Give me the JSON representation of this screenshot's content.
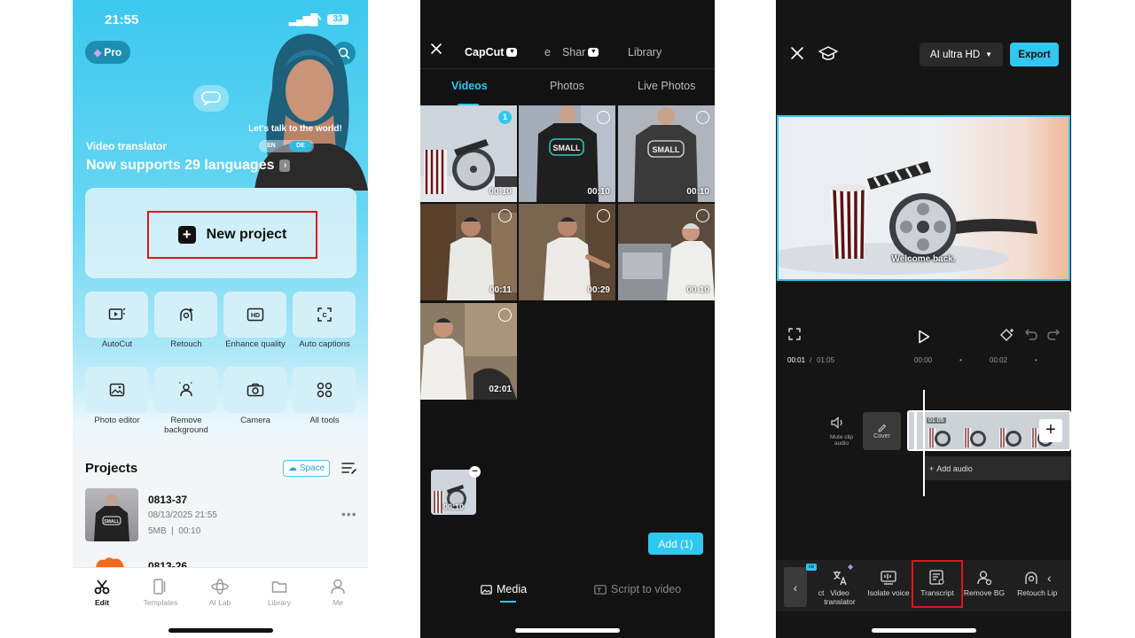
{
  "screen1": {
    "status_time": "21:55",
    "battery": "33",
    "pro_label": "Pro",
    "slogan": "Let's talk to the world!",
    "lang_from": "EN",
    "lang_to": "DE",
    "banner_title": "Video translator",
    "banner_subtitle": "Now supports 29 languages",
    "new_project_label": "New project",
    "tools": [
      {
        "label": "AutoCut",
        "icon": "autocut-icon"
      },
      {
        "label": "Retouch",
        "icon": "retouch-icon"
      },
      {
        "label": "Enhance quality",
        "icon": "hd-icon"
      },
      {
        "label": "Auto captions",
        "icon": "captions-icon"
      },
      {
        "label": "Photo editor",
        "icon": "photo-editor-icon"
      },
      {
        "label": "Remove background",
        "icon": "remove-bg-icon"
      },
      {
        "label": "Camera",
        "icon": "camera-icon"
      },
      {
        "label": "All tools",
        "icon": "grid-icon"
      }
    ],
    "projects_title": "Projects",
    "space_label": "Space",
    "projects": [
      {
        "name": "0813-37",
        "date": "08/13/2025 21:55",
        "size": "5MB",
        "duration": "00:10"
      },
      {
        "name": "0813-26"
      }
    ],
    "nav": [
      {
        "label": "Edit",
        "icon": "scissors-icon",
        "active": true
      },
      {
        "label": "Templates",
        "icon": "templates-icon"
      },
      {
        "label": "AI Lab",
        "icon": "ai-lab-icon"
      },
      {
        "label": "Library",
        "icon": "folder-icon"
      },
      {
        "label": "Me",
        "icon": "person-icon"
      }
    ]
  },
  "screen2": {
    "sources": {
      "capcut": "CapCut",
      "share": "Shar",
      "share_prefix": "e",
      "library": "Library"
    },
    "tabs": [
      "Videos",
      "Photos",
      "Live Photos"
    ],
    "media": [
      {
        "duration": "00:10",
        "selected": "1"
      },
      {
        "duration": "00:10"
      },
      {
        "duration": "00:10"
      },
      {
        "duration": "00:11"
      },
      {
        "duration": "00:29"
      },
      {
        "duration": "00:10"
      },
      {
        "duration": "02:01"
      }
    ],
    "selected_thumb_duration": "00:10",
    "add_button": "Add (1)",
    "bottom_tabs": {
      "media": "Media",
      "script": "Script to video"
    }
  },
  "screen3": {
    "quality_label": "AI ultra HD",
    "export_label": "Export",
    "caption": "Welcome back.",
    "time_current": "00:01",
    "time_total": "01:05",
    "ruler": [
      "00:00",
      "00:02"
    ],
    "mute_label": "Mute clip audio",
    "cover_label": "Cover",
    "clip_duration": "01:05",
    "add_audio_label": "Add audio",
    "toolbar": [
      {
        "label": "ct"
      },
      {
        "label": "Video translator",
        "icon": "translate-icon"
      },
      {
        "label": "Isolate voice",
        "icon": "isolate-voice-icon"
      },
      {
        "label": "Transcript",
        "icon": "transcript-icon"
      },
      {
        "label": "Remove BG",
        "icon": "remove-bg-icon"
      },
      {
        "label": "Retouch",
        "icon": "retouch-icon"
      },
      {
        "label": "Lip"
      }
    ],
    "accent": "#2fc8f0",
    "highlight": "#e0141c"
  }
}
